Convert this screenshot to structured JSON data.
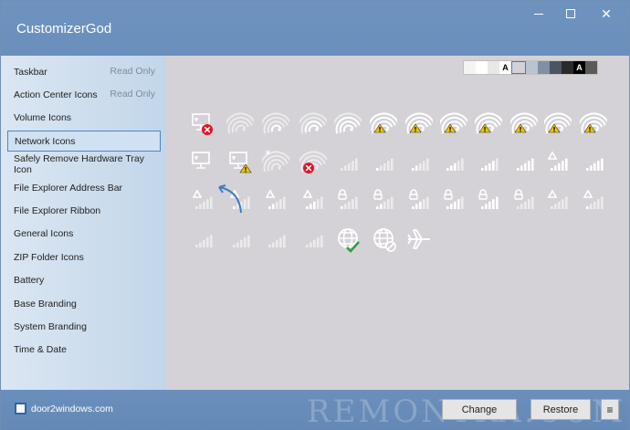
{
  "window": {
    "title": "CustomizerGod",
    "controls": {
      "minimize": "minimize",
      "maximize": "maximize",
      "close": "✕"
    }
  },
  "sidebar": {
    "items": [
      {
        "label": "Taskbar",
        "badge": "Read Only"
      },
      {
        "label": "Action Center Icons",
        "badge": "Read Only"
      },
      {
        "label": "Volume Icons",
        "badge": ""
      },
      {
        "label": "Network Icons",
        "badge": "",
        "selected": true
      },
      {
        "label": "Safely Remove Hardware Tray Icon",
        "badge": ""
      },
      {
        "label": "File Explorer Address Bar",
        "badge": ""
      },
      {
        "label": "File Explorer Ribbon",
        "badge": ""
      },
      {
        "label": "General Icons",
        "badge": ""
      },
      {
        "label": "ZIP Folder Icons",
        "badge": ""
      },
      {
        "label": "Battery",
        "badge": ""
      },
      {
        "label": "Base Branding",
        "badge": ""
      },
      {
        "label": "System Branding",
        "badge": ""
      },
      {
        "label": "Time & Date",
        "badge": ""
      }
    ]
  },
  "background_swatches": [
    {
      "color": "#f4f4f4",
      "label": ""
    },
    {
      "color": "#ffffff",
      "label": ""
    },
    {
      "color": "#e8e8e8",
      "label": ""
    },
    {
      "color": "#ffffff",
      "label": "A"
    },
    {
      "color": "#d4d2d6",
      "label": "",
      "selected": true
    },
    {
      "color": "#b8c4d2",
      "label": ""
    },
    {
      "color": "#7f8fa4",
      "label": ""
    },
    {
      "color": "#4a5563",
      "label": ""
    },
    {
      "color": "#2a2a2a",
      "label": ""
    },
    {
      "color": "#000000",
      "label": "A"
    },
    {
      "color": "#5a5a5a",
      "label": ""
    }
  ],
  "icon_grid": {
    "rows": [
      [
        "network-disconnected-icon",
        "wifi-0-bars-icon",
        "wifi-1-bar-icon",
        "wifi-2-bars-icon",
        "wifi-3-bars-icon",
        "wifi-warning-1-icon",
        "wifi-warning-2-icon",
        "wifi-warning-3-icon",
        "wifi-warning-4-icon",
        "wifi-warning-5-icon",
        "wifi-warning-6-icon",
        "wifi-warning-7-icon"
      ],
      [
        "network-wired-icon",
        "network-wired-warning-icon",
        "wifi-asterisk-icon",
        "wifi-error-icon",
        "signal-0-bars-icon",
        "signal-1-bar-icon",
        "signal-2-bars-icon",
        "signal-3-bars-icon",
        "signal-4-bars-icon",
        "signal-5-bars-icon",
        "signal-triangle-5-icon",
        "signal-full-icon"
      ],
      [
        "signal-triangle-0-icon",
        "signal-triangle-1-icon",
        "signal-triangle-2-icon",
        "signal-triangle-3-icon",
        "signal-lock-1-icon",
        "signal-lock-2-icon",
        "signal-lock-3-icon",
        "signal-lock-4-icon",
        "signal-lock-5-icon",
        "signal-lock-6-icon",
        "signal-triangle-6-icon",
        "signal-triangle-7-icon"
      ],
      [
        "signal-dim-1-icon",
        "signal-dim-2-icon",
        "signal-dim-3-icon",
        "signal-dim-4-icon",
        "globe-check-icon",
        "globe-blocked-icon",
        "airplane-mode-icon"
      ]
    ]
  },
  "bottom": {
    "brand": "door2windows.com",
    "watermark": "REMONTKA.COM",
    "change_label": "Change",
    "restore_label": "Restore",
    "menu_label": "≡"
  },
  "colors": {
    "titlebar": "#6a8fbc",
    "sidebar": "#c8daed",
    "main": "#d4d2d6",
    "accent": "#3d7cc9",
    "error": "#e81123",
    "warning": "#f2c500"
  }
}
